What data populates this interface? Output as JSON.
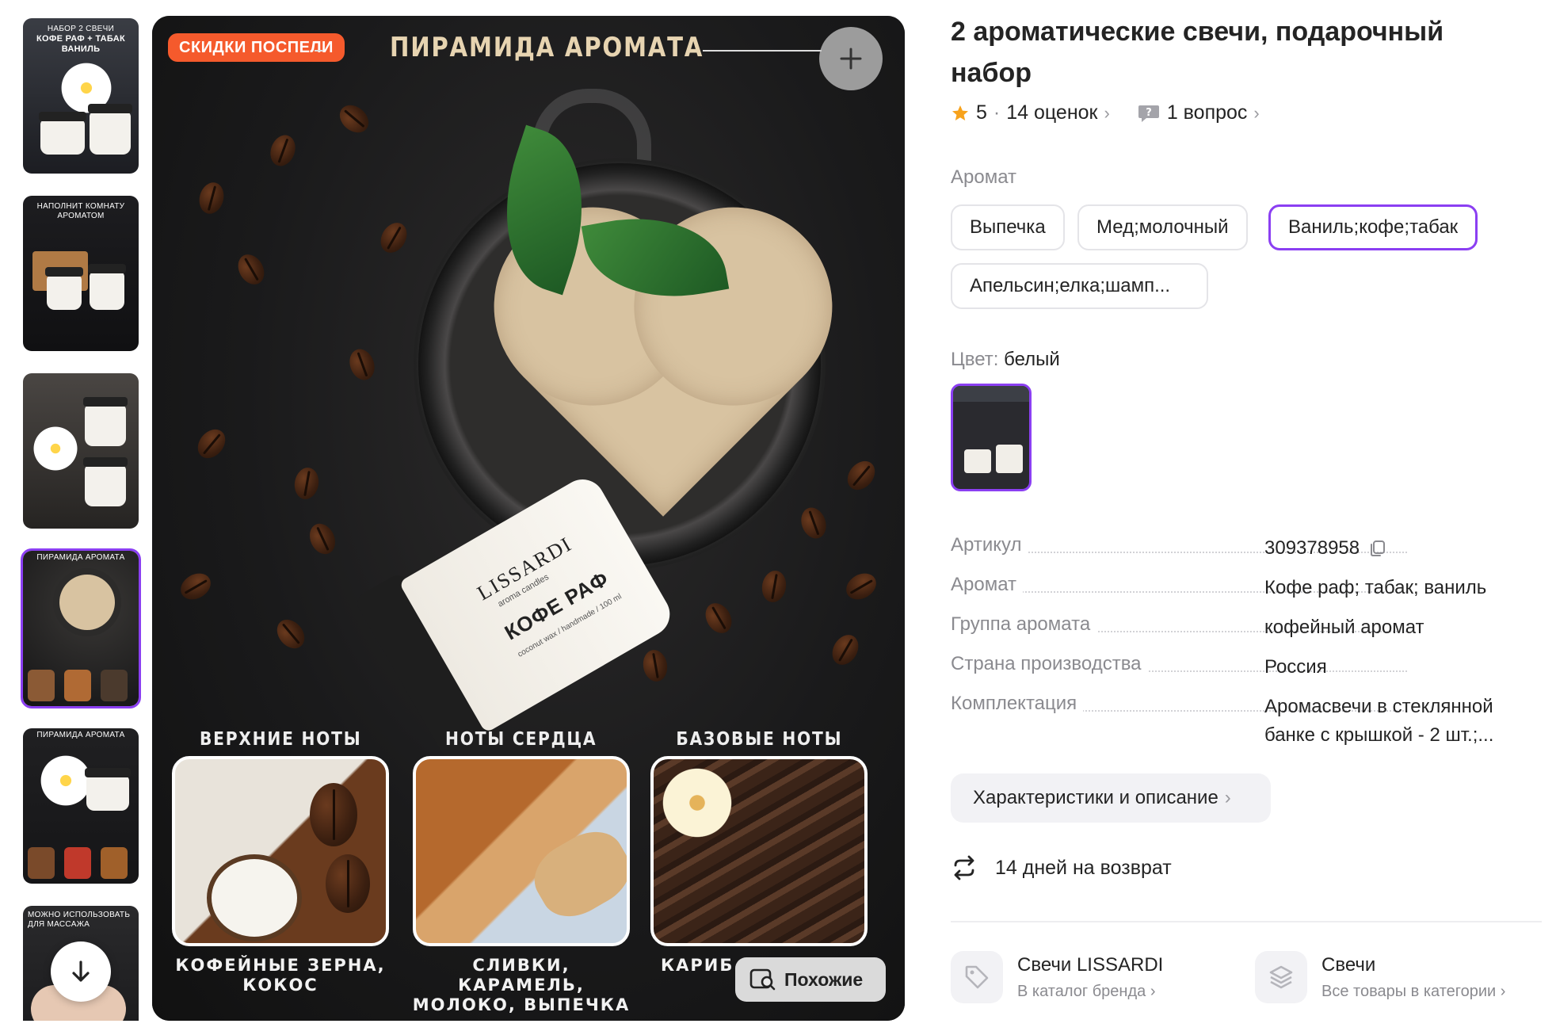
{
  "gallery": {
    "thumbnails": [
      {
        "caption_small": "НАБОР 2 СВЕЧИ",
        "caption": "КОФЕ РАФ + ТАБАК ВАНИЛЬ"
      },
      {
        "caption_small": "НАПОЛНИТ КОМНАТУ АРОМАТОМ",
        "caption": ""
      },
      {
        "caption_small": "",
        "caption": ""
      },
      {
        "caption_small": "ПИРАМИДА АРОМАТА",
        "caption": ""
      },
      {
        "caption_small": "ПИРАМИДА АРОМАТА",
        "caption": ""
      },
      {
        "caption_small": "МОЖНО ИСПОЛЬЗОВАТЬ ДЛЯ МАССАЖА",
        "caption": ""
      }
    ],
    "selected_index": 3
  },
  "main_image": {
    "badge": "СКИДКИ ПОСПЕЛИ",
    "heading": "ПИРАМИДА АРОМАТА",
    "candle_brand": "LISSARDI",
    "candle_sub": "aroma candles",
    "candle_name": "КОФЕ РАФ",
    "candle_tiny": "coconut wax / handmade / 100 ml",
    "notes": [
      {
        "head": "ВЕРХНИЕ НОТЫ",
        "caption": "КОФЕЙНЫЕ ЗЕРНА, КОКОС"
      },
      {
        "head": "НОТЫ СЕРДЦА",
        "caption": "СЛИВКИ, КАРАМЕЛЬ, МОЛОКО, ВЫПЕЧКА"
      },
      {
        "head": "БАЗОВЫЕ НОТЫ",
        "caption": "КАРИБ"
      }
    ],
    "similar_label": "Похожие"
  },
  "product": {
    "title": "2 ароматические свечи, подарочный набор",
    "rating": "5",
    "reviews": "14 оценок",
    "questions": "1 вопрос",
    "aroma_label": "Аромат",
    "aroma_options": [
      "Выпечка",
      "Мед;молочный",
      "Ваниль;кофе;табак",
      "Апельсин;елка;шамп..."
    ],
    "aroma_selected": 2,
    "color_label": "Цвет:",
    "color_value": "белый",
    "specs": [
      {
        "key": "Артикул",
        "value": "309378958"
      },
      {
        "key": "Аромат",
        "value": "Кофе раф; табак; ваниль"
      },
      {
        "key": "Группа аромата",
        "value": "кофейный аромат"
      },
      {
        "key": "Страна производства",
        "value": "Россия"
      },
      {
        "key": "Комплектация",
        "value": "Аромасвечи в стеклянной банке с крышкой - 2 шт.;..."
      }
    ],
    "details_button": "Характеристики и описание",
    "return_text": "14 дней на возврат",
    "brand_card": {
      "title": "Свечи LISSARDI",
      "link": "В каталог бренда"
    },
    "category_card": {
      "title": "Свечи",
      "link": "Все товары в категории"
    }
  },
  "colors": {
    "accent": "#8b3ff2",
    "badge": "#f55a2c",
    "star": "#f7a21b"
  }
}
